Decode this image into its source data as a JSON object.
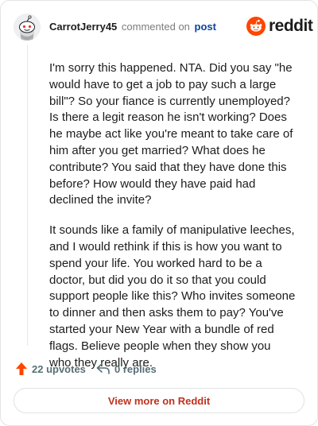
{
  "comment": {
    "username": "CarrotJerry45",
    "action_text": "commented on",
    "post_link": "post",
    "paragraphs": [
      "I'm sorry this happened. NTA. Did you say \"he would have to get a job to pay such a large bill\"? So your fiance is currently unemployed? Is there a legit reason he isn't working? Does he maybe act like you're meant to take care of him after you get married? What does he contribute? You said that they have done this before? How would they have paid had declined the invite?",
      "It sounds like a family of manipulative leeches, and I would rethink if this is how you want to spend your life. You worked hard to be a doctor, but did you do it so that you could support people like this? Who invites someone to dinner and then asks them to pay? You've started your New Year with a bundle of red flags. Believe people when they show you who they really are."
    ],
    "upvotes": "22 upvotes",
    "replies": "0 replies"
  },
  "brand": {
    "logo_text": "reddit",
    "logo_icon": "reddit-snoo-icon",
    "accent": "#ff4500"
  },
  "footer": {
    "view_more_label": "View more on Reddit"
  },
  "icons": {
    "avatar": "snoo-avatar",
    "upvote": "upvote-arrow-icon",
    "reply": "reply-arrow-icon"
  }
}
